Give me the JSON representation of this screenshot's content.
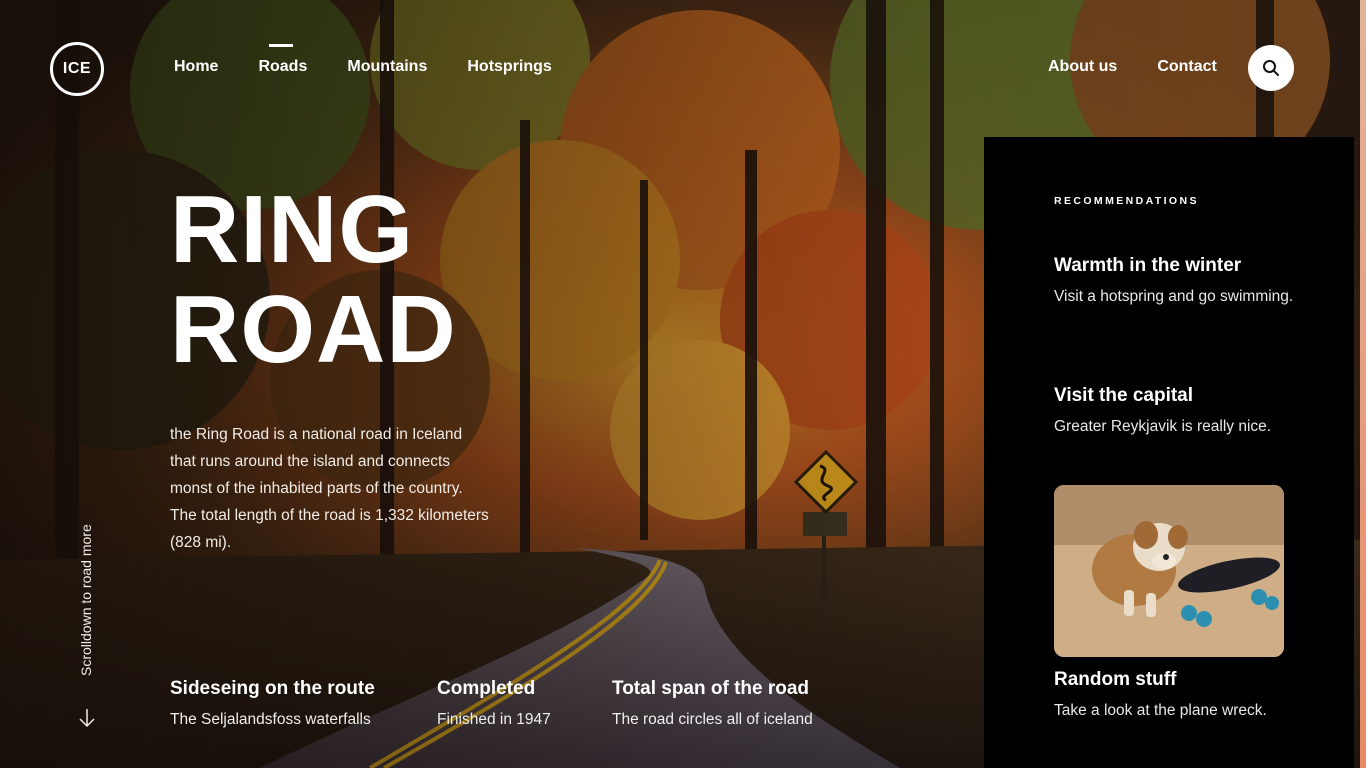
{
  "brand": {
    "logo_text": "ICE"
  },
  "nav": {
    "left": [
      {
        "label": "Home",
        "active": false
      },
      {
        "label": "Roads",
        "active": true
      },
      {
        "label": "Mountains",
        "active": false
      },
      {
        "label": "Hotsprings",
        "active": false
      }
    ],
    "right": [
      {
        "label": "About us"
      },
      {
        "label": "Contact"
      }
    ],
    "search_icon": "search-icon"
  },
  "hero": {
    "title_line1": "RING",
    "title_line2": "ROAD",
    "description": "the Ring Road is a national road in Iceland that runs around the island and connects monst of the inhabited parts of the country. The total length of the road is 1,332 kilometers (828 mi)."
  },
  "scroll_hint": {
    "label": "Scrolldown to road more",
    "icon": "arrow-down-icon"
  },
  "stats": [
    {
      "title": "Sideseing on the route",
      "text": "The Seljalandsfoss waterfalls"
    },
    {
      "title": "Completed",
      "text": "Finished in 1947"
    },
    {
      "title": "Total span of the road",
      "text": "The road circles all of iceland"
    }
  ],
  "recommendations": {
    "heading": "RECOMMENDATIONS",
    "items": [
      {
        "title": "Warmth in the winter",
        "text": "Visit a hotspring and go swimming."
      },
      {
        "title": "Visit the capital",
        "text": "Greater Reykjavik is really nice."
      },
      {
        "title": "Random stuff",
        "text": "Take a look at the plane wreck."
      }
    ]
  },
  "colors": {
    "panel_bg": "#000000",
    "accent_edge": "#e78a66",
    "text": "#ffffff"
  }
}
